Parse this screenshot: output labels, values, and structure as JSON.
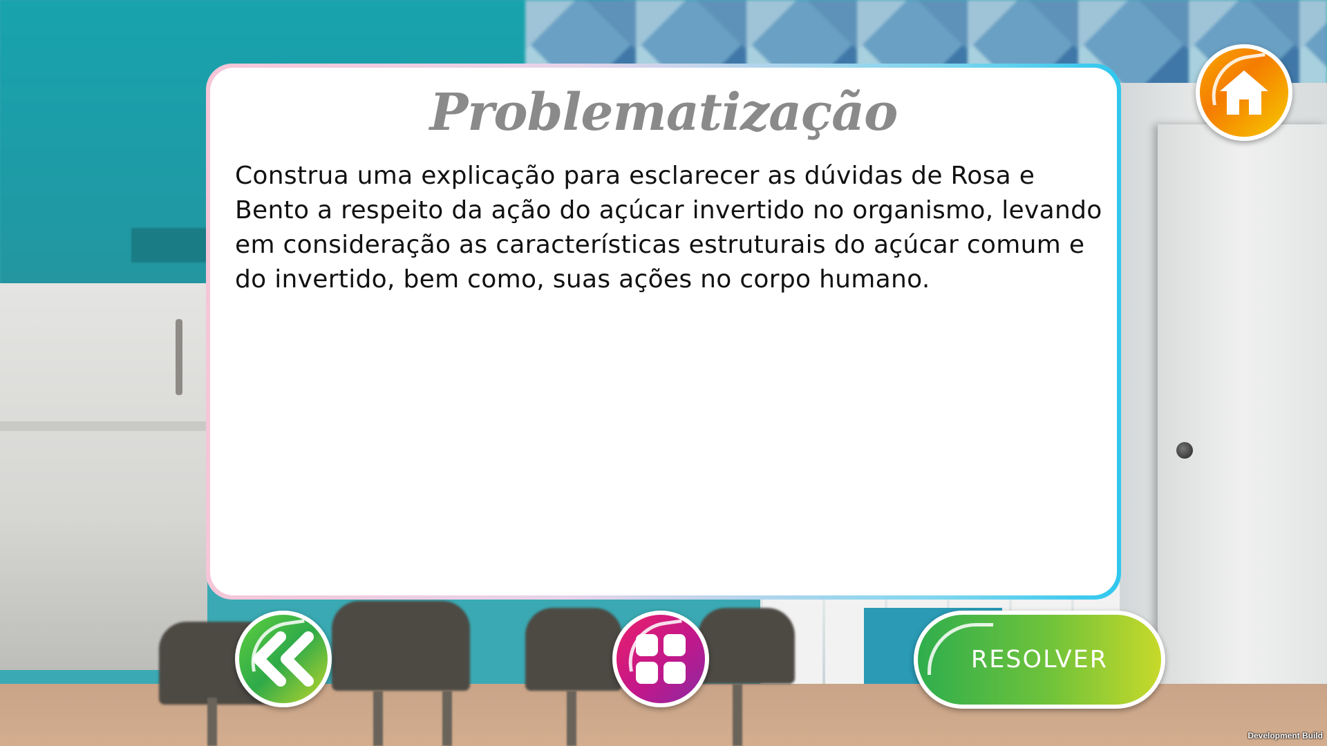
{
  "dialog": {
    "title": "Problematização",
    "body": "Construa uma explicação para esclarecer as dúvidas de Rosa e Bento a respeito da ação do açúcar invertido no organismo, levando em consideração as características estruturais do açúcar comum e do invertido, bem como, suas ações no corpo humano."
  },
  "buttons": {
    "home_icon": "home-icon",
    "back_icon": "double-chevron-left-icon",
    "menu_icon": "grid-four-squares-icon",
    "resolver_label": "RESOLVER"
  },
  "footer": {
    "build_label": "Development Build"
  },
  "colors": {
    "title": "#8a8a8a",
    "body_text": "#111111",
    "home_button": "#f57c00",
    "back_button": "#2eaa49",
    "menu_button": "#c2178a",
    "resolver_button": "#71c33a",
    "card_border_accent": "#2fc7ee"
  }
}
